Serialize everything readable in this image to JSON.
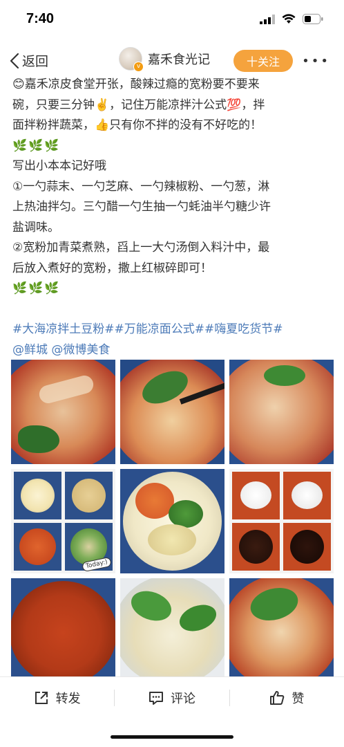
{
  "status": {
    "time": "7:40"
  },
  "nav": {
    "back_label": "返回",
    "username": "嘉禾食光记",
    "follow_label": "十关注",
    "more_label": "•••"
  },
  "post": {
    "line1": "😊嘉禾凉皮食堂开张，酸辣过瘾的宽粉要不要来",
    "line2": "碗，只要三分钟✌️，记住万能凉拌汁公式💯，拌",
    "line3": "面拌粉拌蔬菜，👍只有你不拌的没有不好吃的！",
    "plants1": "🌿🌿🌿",
    "line4": "写出小本本记好哦",
    "line5": "①一勺蒜末、一勺芝麻、一勺辣椒粉、一勺葱，淋",
    "line6": "上热油拌匀。三勺醋一勺生抽一勺蚝油半勺糖少许",
    "line7": "盐调味。",
    "line8": "②宽粉加青菜煮熟，舀上一大勺汤倒入料汁中，最",
    "line9": "后放入煮好的宽粉，撒上红椒碎即可！",
    "plants2": "🌿🌿🌿",
    "tags": "#大海凉拌土豆粉##万能凉面公式##嗨夏吃货节#",
    "mentions": "@鲜城 @微博美食"
  },
  "photos": {
    "sticker": "Today:)"
  },
  "tabbar": {
    "repost": "转发",
    "comment": "评论",
    "like": "赞"
  },
  "colors": {
    "accent": "#f5a33d",
    "link": "#4d7bb8",
    "plant": "#3a8a2f"
  }
}
